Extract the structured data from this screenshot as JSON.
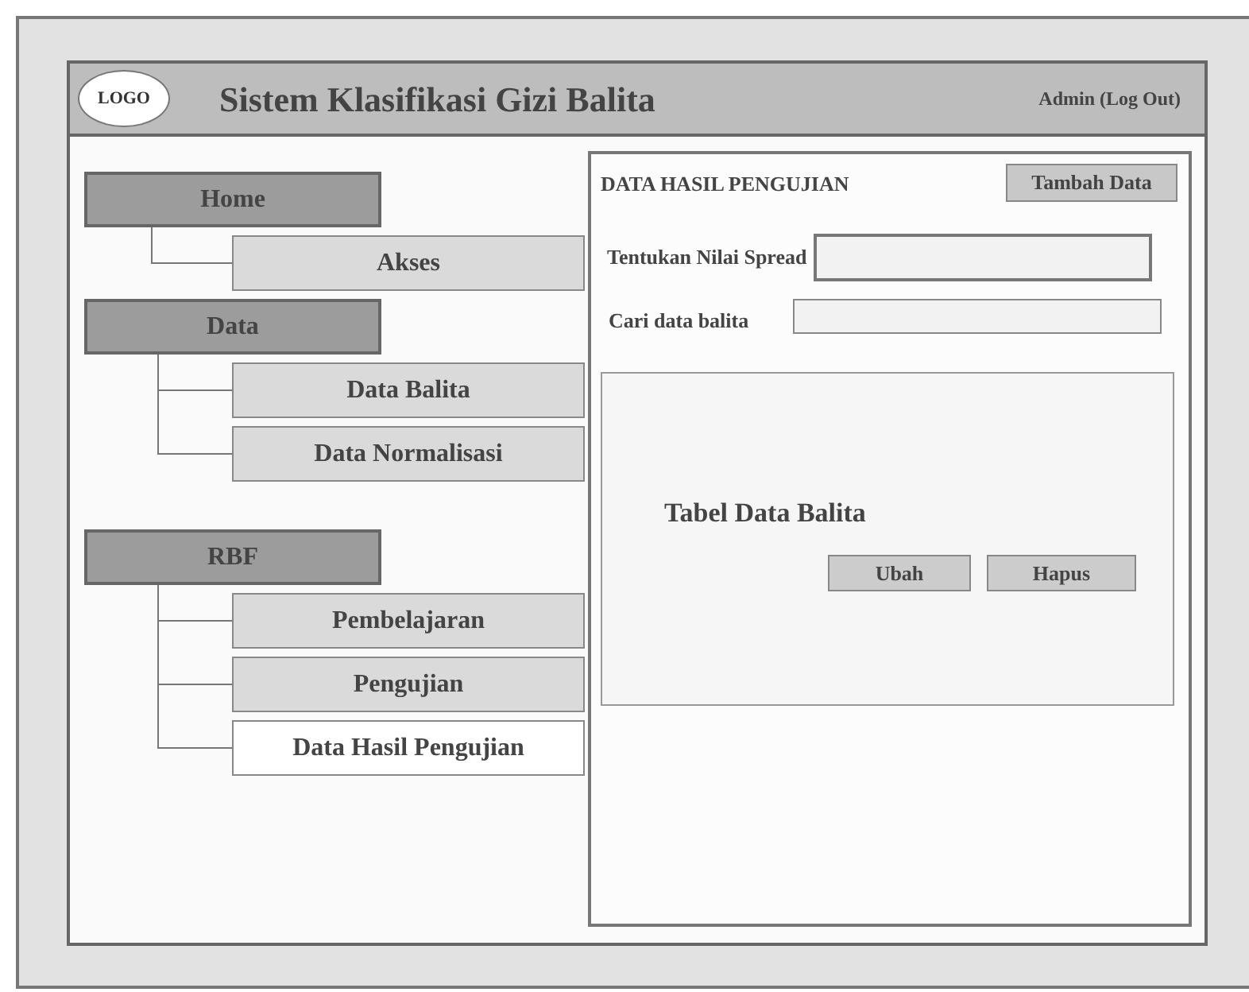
{
  "window": {
    "logo": "LOGO",
    "title": "Sistem Klasifikasi Gizi Balita",
    "user_link": "Admin (Log Out)"
  },
  "sidebar": {
    "groups": [
      {
        "label": "Home",
        "children": [
          {
            "label": "Akses",
            "selected": false
          }
        ]
      },
      {
        "label": "Data",
        "children": [
          {
            "label": "Data Balita",
            "selected": false
          },
          {
            "label": "Data Normalisasi",
            "selected": false
          }
        ]
      },
      {
        "label": "RBF",
        "children": [
          {
            "label": "Pembelajaran",
            "selected": false
          },
          {
            "label": "Pengujian",
            "selected": false
          },
          {
            "label": "Data Hasil Pengujian",
            "selected": true
          }
        ]
      }
    ]
  },
  "panel": {
    "title": "DATA HASIL PENGUJIAN",
    "add_button": "Tambah Data",
    "fields": [
      {
        "label": "Tentukan Nilai Spread"
      },
      {
        "label": "Cari data balita"
      }
    ],
    "table": {
      "caption": "Tabel Data Balita",
      "buttons": [
        "Ubah",
        "Hapus"
      ]
    }
  }
}
